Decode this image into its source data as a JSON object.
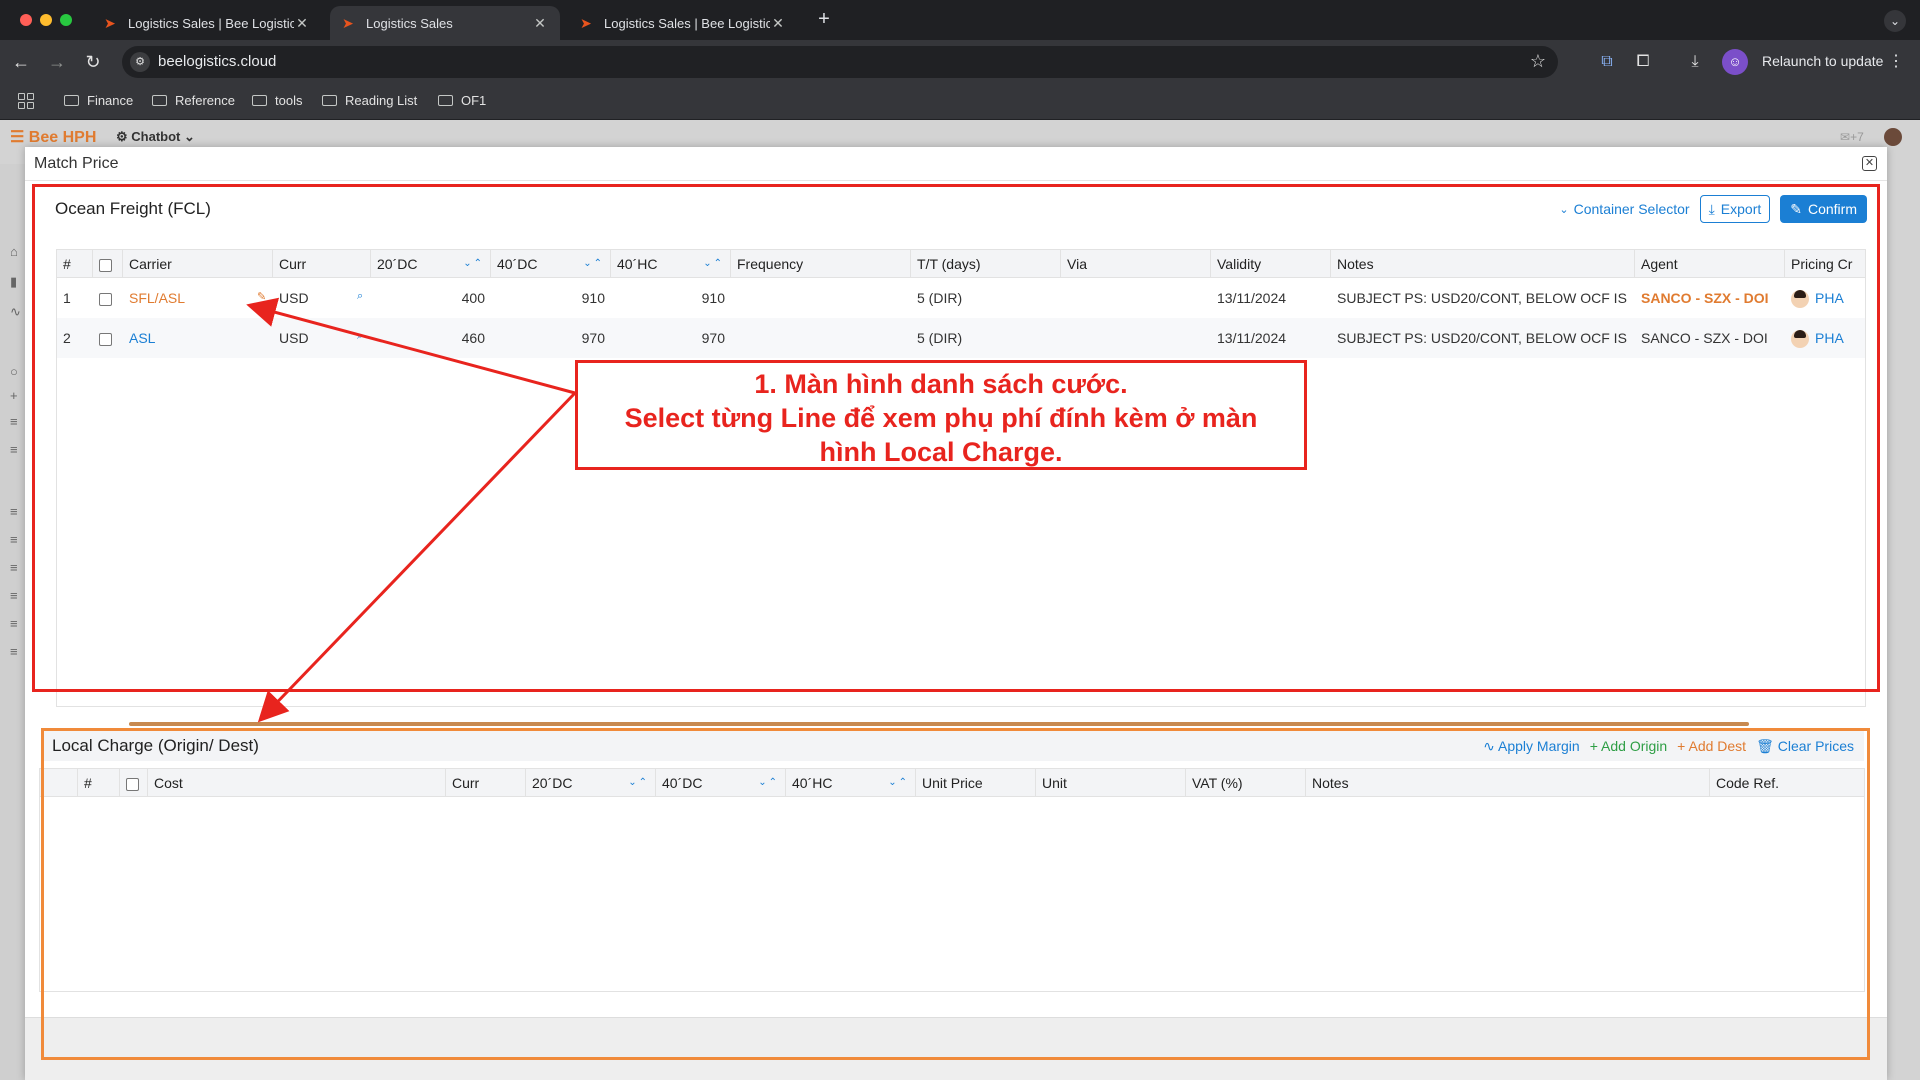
{
  "browser": {
    "tabs": [
      {
        "label": "Logistics Sales | Bee Logistic",
        "active": false
      },
      {
        "label": "Logistics Sales",
        "active": true
      },
      {
        "label": "Logistics Sales | Bee Logistic",
        "active": false
      }
    ],
    "new_tab": "+",
    "url": "beelogistics.cloud",
    "relaunch_label": "Relaunch to update",
    "bookmarks": [
      "Finance",
      "Reference",
      "tools",
      "Reading List",
      "OF1"
    ]
  },
  "app": {
    "brand": "Bee HPH",
    "chatbot_label": "Chatbot",
    "notif_count": "+7"
  },
  "modal": {
    "title": "Match Price"
  },
  "fcl": {
    "title": "Ocean Freight (FCL)",
    "container_selector": "Container Selector",
    "export_label": "Export",
    "confirm_label": "Confirm",
    "columns": [
      "#",
      "",
      "Carrier",
      "Curr",
      "20´DC",
      "40´DC",
      "40´HC",
      "Frequency",
      "T/T (days)",
      "Via",
      "Validity",
      "Notes",
      "Agent",
      "Pricing Cr"
    ],
    "rows": [
      {
        "no": "1",
        "carrier": "SFL/ASL",
        "curr": "USD",
        "dc20": "400",
        "dc40": "910",
        "hc40": "910",
        "frequency": "",
        "tt": "5 (DIR)",
        "via": "",
        "validity": "13/11/2024",
        "notes": "SUBJECT PS: USD20/CONT, BELOW OCF IS",
        "agent": "SANCO - SZX - DOI",
        "pricing": "PHA"
      },
      {
        "no": "2",
        "carrier": "ASL",
        "curr": "USD",
        "dc20": "460",
        "dc40": "970",
        "hc40": "970",
        "frequency": "",
        "tt": "5 (DIR)",
        "via": "",
        "validity": "13/11/2024",
        "notes": "SUBJECT PS: USD20/CONT, BELOW OCF IS",
        "agent": "SANCO - SZX - DOI",
        "pricing": "PHA"
      }
    ]
  },
  "local_charge": {
    "title": "Local Charge (Origin/ Dest)",
    "apply_margin": "Apply Margin",
    "add_origin": "Add Origin",
    "add_dest": "Add Dest",
    "clear_prices": "Clear Prices",
    "columns": [
      "",
      "#",
      "",
      "Cost",
      "Curr",
      "20´DC",
      "40´DC",
      "40´HC",
      "Unit Price",
      "Unit",
      "VAT (%)",
      "Notes",
      "Code Ref."
    ]
  },
  "annotation": {
    "line1": "1. Màn hình danh sách cước.",
    "line2": "Select từng Line để xem phụ phí đính kèm ở màn",
    "line3": "hình Local Charge."
  },
  "colors": {
    "accent": "#1b7fd4",
    "brand_orange": "#e07b30",
    "annotation_red": "#e8241e",
    "annotation_orange": "#f08a3a"
  }
}
